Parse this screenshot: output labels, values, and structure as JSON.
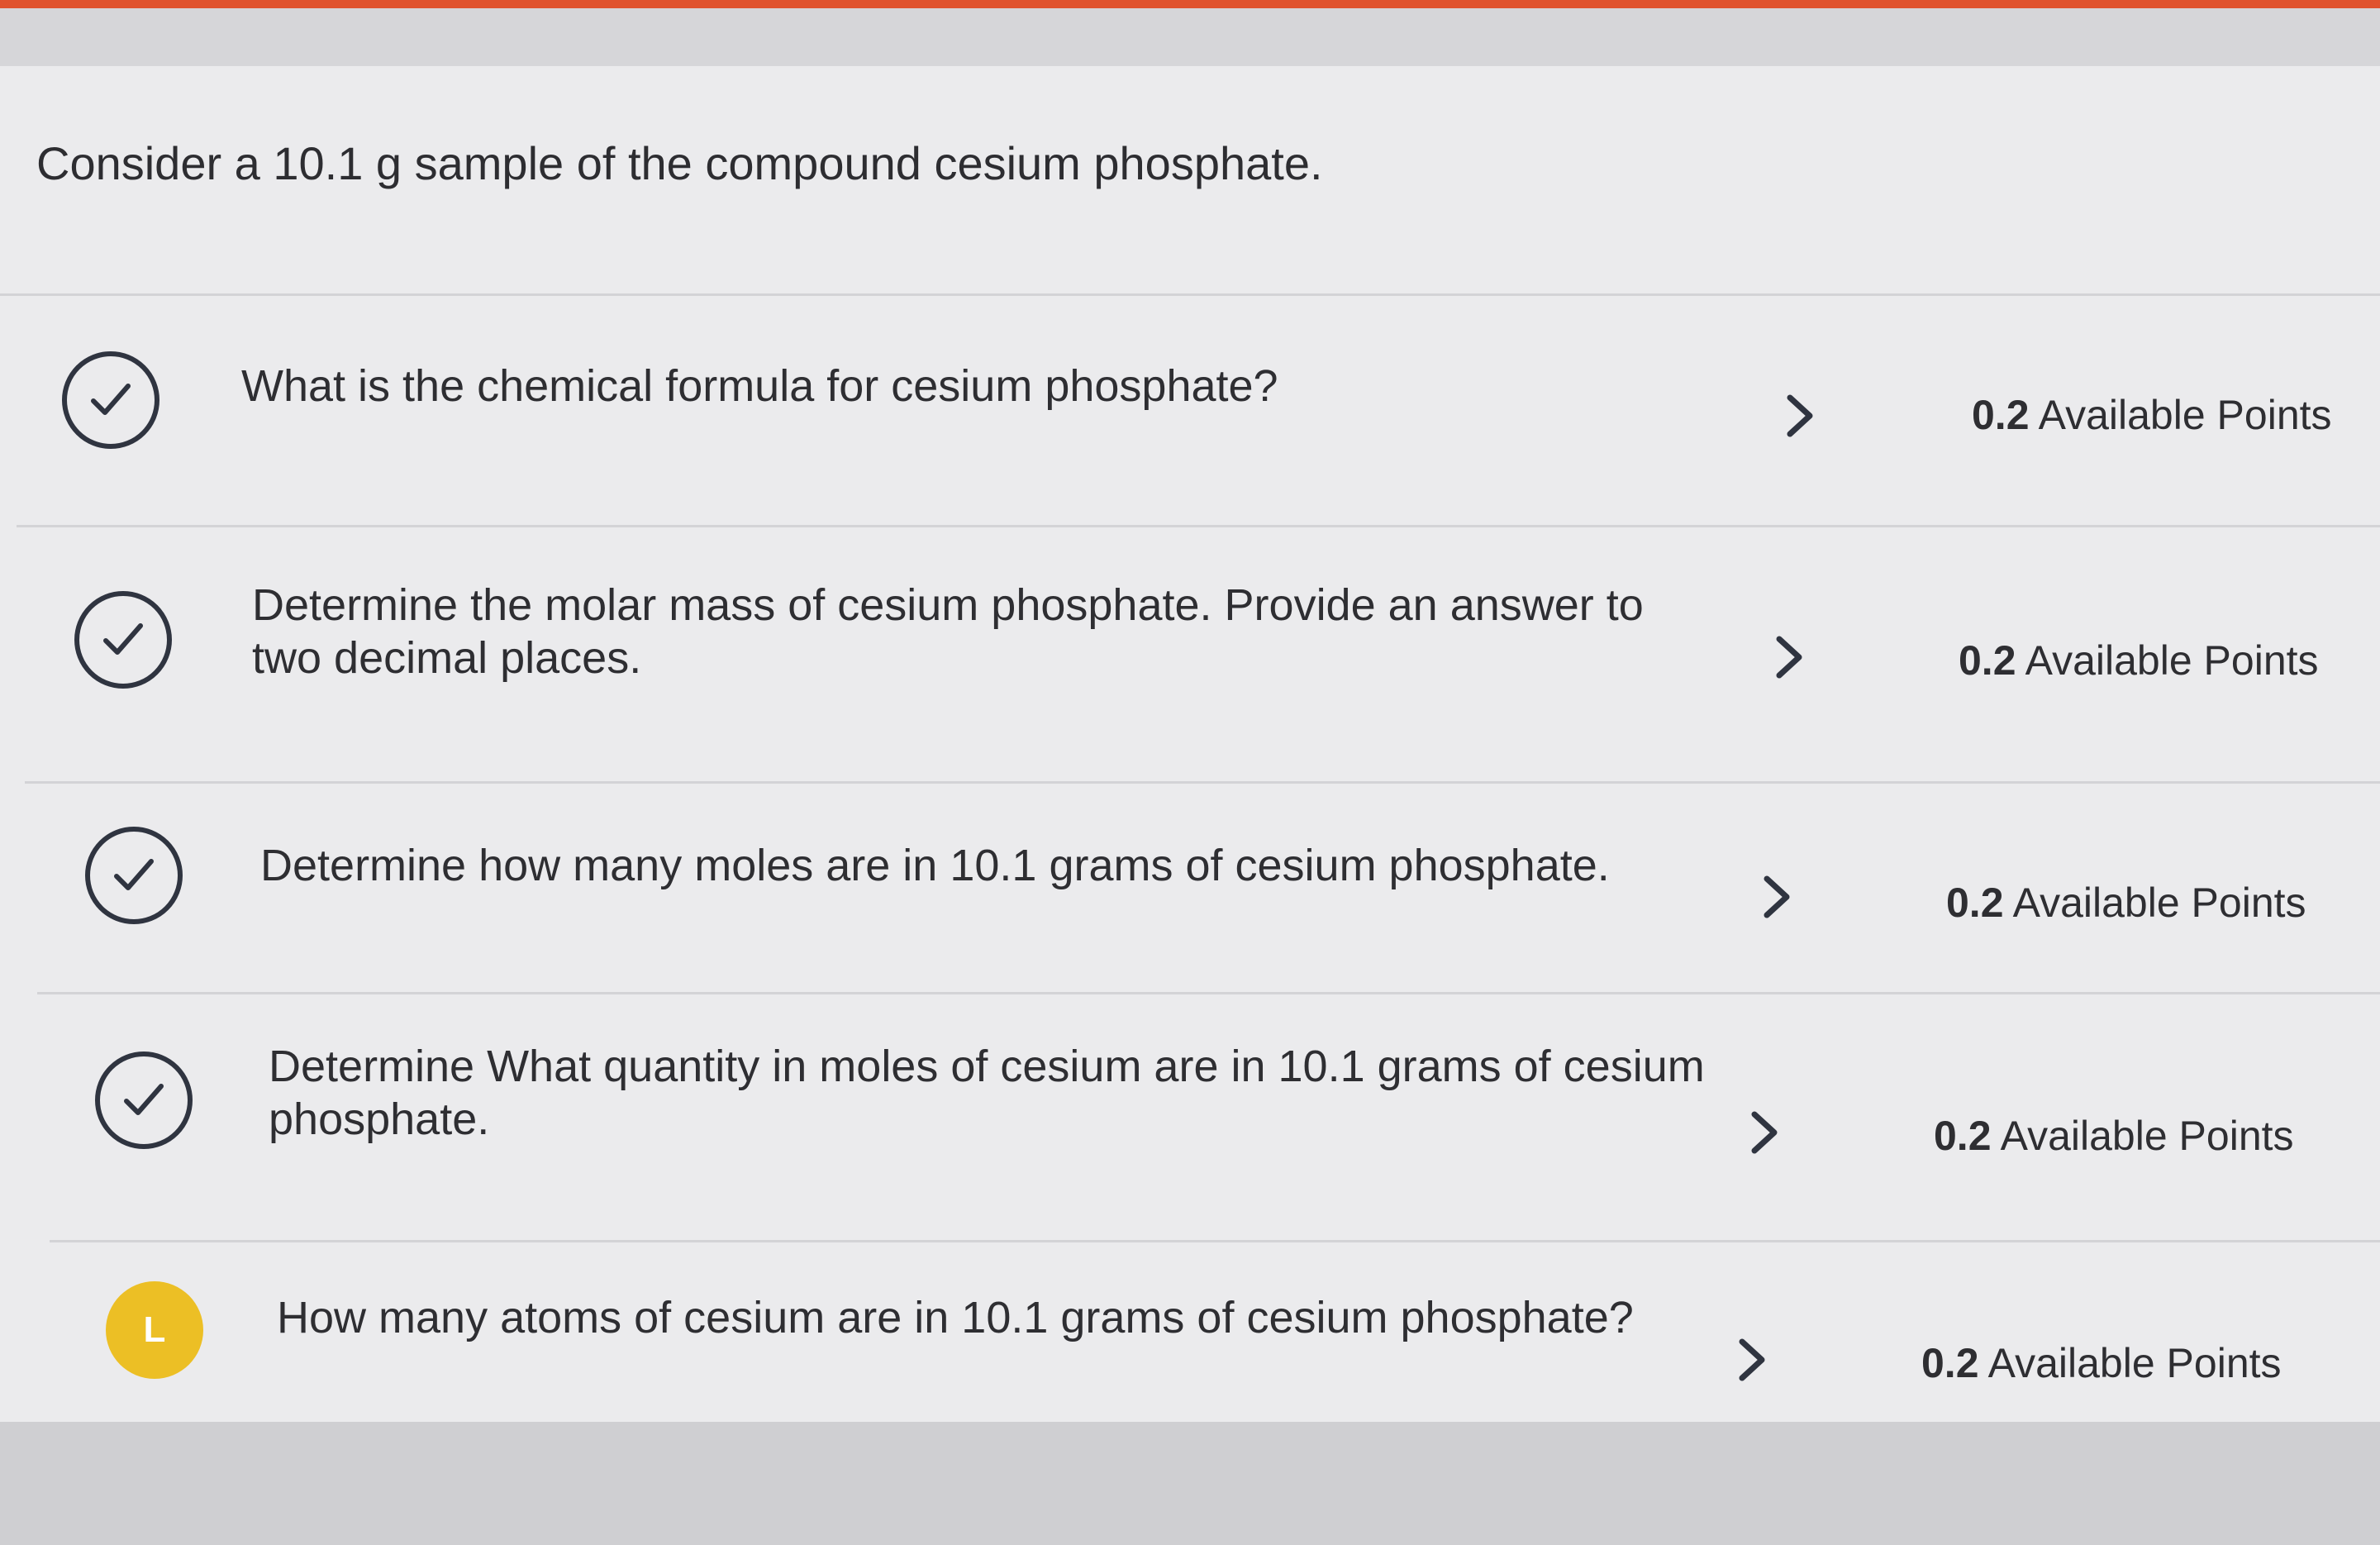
{
  "intro": {
    "text": "Consider a 10.1 g sample of the compound cesium phosphate."
  },
  "colors": {
    "accent": "#e0532f",
    "complete_icon": "#2f3440",
    "in_progress_icon": "#ecbf25"
  },
  "questions": [
    {
      "status": "complete",
      "status_icon": "checkmark-circle-icon",
      "text": "What is the chemical formula for cesium phosphate?",
      "points_value": "0.2",
      "points_label": "Available Points"
    },
    {
      "status": "complete",
      "status_icon": "checkmark-circle-icon",
      "text": "Determine the molar mass of cesium phosphate. Provide an answer to two decimal places.",
      "points_value": "0.2",
      "points_label": "Available Points"
    },
    {
      "status": "complete",
      "status_icon": "checkmark-circle-icon",
      "text": "Determine how many moles are in 10.1 grams of cesium phosphate.",
      "points_value": "0.2",
      "points_label": "Available Points"
    },
    {
      "status": "complete",
      "status_icon": "checkmark-circle-icon",
      "text": "Determine What quantity in moles of cesium are in 10.1 grams of cesium phosphate.",
      "points_value": "0.2",
      "points_label": "Available Points"
    },
    {
      "status": "in-progress",
      "status_icon": "in-progress-circle-icon",
      "status_letter": "L",
      "text": "How many atoms of cesium are in 10.1 grams of cesium phosphate?",
      "points_value": "0.2",
      "points_label": "Available Points"
    }
  ]
}
